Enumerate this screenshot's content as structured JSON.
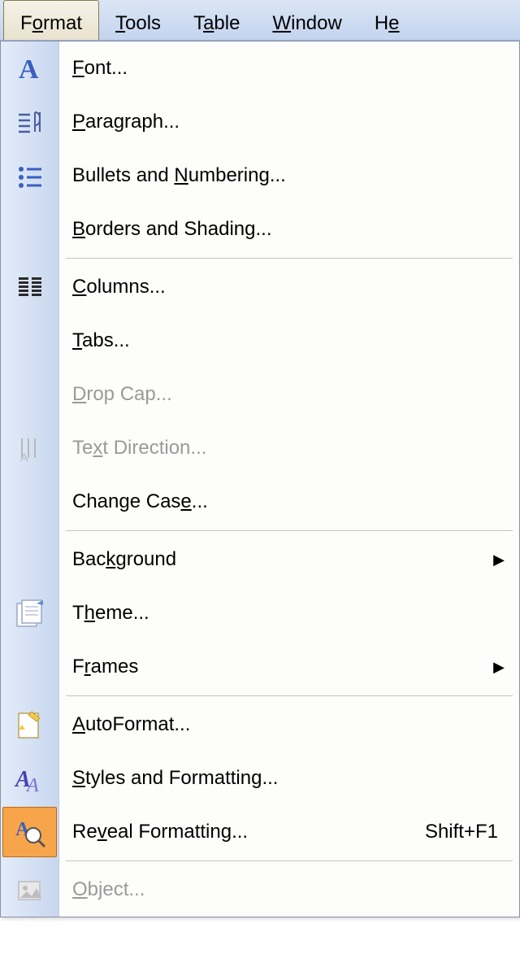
{
  "menubar": {
    "items": [
      {
        "pre": "F",
        "ul": "o",
        "post": "rmat",
        "active": true
      },
      {
        "pre": "",
        "ul": "T",
        "post": "ools",
        "active": false
      },
      {
        "pre": "T",
        "ul": "a",
        "post": "ble",
        "active": false
      },
      {
        "pre": "",
        "ul": "W",
        "post": "indow",
        "active": false
      },
      {
        "pre": "H",
        "ul": "e",
        "post": "",
        "active": false
      }
    ]
  },
  "menu": {
    "font": {
      "pre": "",
      "ul": "F",
      "post": "ont..."
    },
    "paragraph": {
      "pre": "",
      "ul": "P",
      "post": "aragraph..."
    },
    "bullets": {
      "pre": "Bullets and ",
      "ul": "N",
      "post": "umbering..."
    },
    "borders": {
      "pre": "",
      "ul": "B",
      "post": "orders and Shading..."
    },
    "columns": {
      "pre": "",
      "ul": "C",
      "post": "olumns..."
    },
    "tabs": {
      "pre": "",
      "ul": "T",
      "post": "abs..."
    },
    "dropcap": {
      "pre": "",
      "ul": "D",
      "post": "rop Cap..."
    },
    "textdir": {
      "pre": "Te",
      "ul": "x",
      "post": "t Direction..."
    },
    "changecase": {
      "pre": "Change Cas",
      "ul": "e",
      "post": "..."
    },
    "background": {
      "pre": "Bac",
      "ul": "k",
      "post": "ground"
    },
    "theme": {
      "pre": "T",
      "ul": "h",
      "post": "eme..."
    },
    "frames": {
      "pre": "F",
      "ul": "r",
      "post": "ames"
    },
    "autoformat": {
      "pre": "",
      "ul": "A",
      "post": "utoFormat..."
    },
    "styles": {
      "pre": "",
      "ul": "S",
      "post": "tyles and Formatting..."
    },
    "reveal": {
      "pre": "Re",
      "ul": "v",
      "post": "eal Formatting...",
      "shortcut": "Shift+F1"
    },
    "object": {
      "pre": "",
      "ul": "O",
      "post": "bject..."
    }
  }
}
